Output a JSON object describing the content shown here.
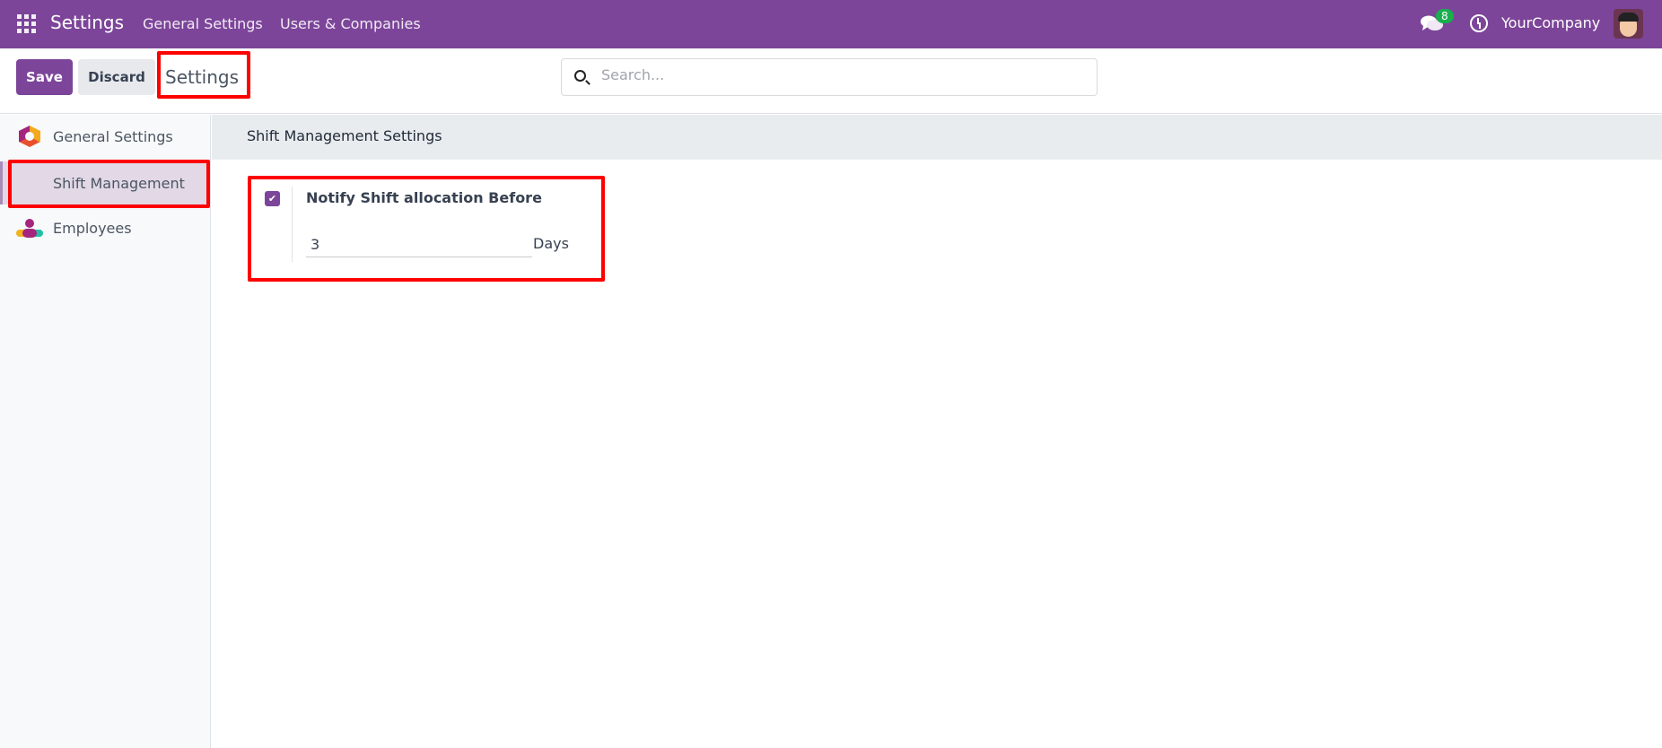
{
  "navbar": {
    "app_title": "Settings",
    "menu": [
      "General Settings",
      "Users & Companies"
    ],
    "messages_count": "8",
    "company": "YourCompany"
  },
  "control_panel": {
    "save_label": "Save",
    "discard_label": "Discard",
    "title": "Settings",
    "search_placeholder": "Search..."
  },
  "sidebar": {
    "items": [
      {
        "label": "General Settings"
      },
      {
        "label": "Shift Management",
        "active": true
      },
      {
        "label": "Employees"
      }
    ]
  },
  "main": {
    "section_title": "Shift Management Settings",
    "setting": {
      "label": "Notify Shift allocation Before",
      "checked": true,
      "value": "3",
      "unit": "Days"
    }
  },
  "colors": {
    "brand": "#7c4599",
    "highlight": "#ff0000",
    "badge": "#1aae4f"
  }
}
